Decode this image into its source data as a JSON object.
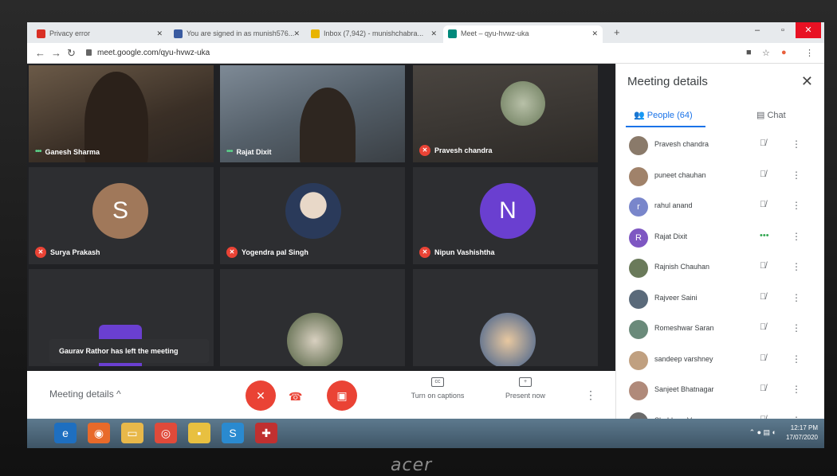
{
  "browser": {
    "tabs": [
      {
        "title": "Privacy error",
        "color": "#d93025"
      },
      {
        "title": "You are signed in as munish576...",
        "color": "#3a5ba0"
      },
      {
        "title": "Inbox (7,942) - munishchabra...",
        "color": "#e8b400"
      },
      {
        "title": "Meet – qyu-hvwz-uka",
        "color": "#00897b"
      }
    ],
    "url": "meet.google.com/qyu-hvwz-uka"
  },
  "tiles": [
    {
      "name": "Ganesh Sharma",
      "status": "speaking"
    },
    {
      "name": "Rajat Dixit",
      "status": "speaking"
    },
    {
      "name": "Pravesh chandra",
      "status": "muted"
    },
    {
      "name": "Surya Prakash",
      "status": "muted",
      "initial": "S",
      "avatar_color": "#a0785a"
    },
    {
      "name": "Yogendra pal Singh",
      "status": "muted"
    },
    {
      "name": "Nipun Vashishtha",
      "status": "muted",
      "initial": "N",
      "avatar_color": "#6a3fd0"
    }
  ],
  "toast": "Gaurav Rathor has left the meeting",
  "bottombar": {
    "meeting_details": "Meeting details",
    "captions": "Turn on captions",
    "present": "Present now"
  },
  "panel": {
    "title": "Meeting details",
    "people_tab": "People (64)",
    "chat_tab": "Chat",
    "people": [
      {
        "name": "Pravesh chandra",
        "initial": "",
        "color": "#8a7a6a",
        "status": "muted"
      },
      {
        "name": "puneet chauhan",
        "initial": "",
        "color": "#a0826a",
        "status": "muted"
      },
      {
        "name": "rahul anand",
        "initial": "r",
        "color": "#7986cb",
        "status": "muted"
      },
      {
        "name": "Rajat Dixit",
        "initial": "R",
        "color": "#7e57c2",
        "status": "speaking"
      },
      {
        "name": "Rajnish Chauhan",
        "initial": "",
        "color": "#6a7a5a",
        "status": "muted"
      },
      {
        "name": "Rajveer Saini",
        "initial": "",
        "color": "#5a6a7a",
        "status": "muted"
      },
      {
        "name": "Romeshwar Saran",
        "initial": "",
        "color": "#6a8a7a",
        "status": "muted"
      },
      {
        "name": "sandeep varshney",
        "initial": "",
        "color": "#c0a080",
        "status": "muted"
      },
      {
        "name": "Sanjeet Bhatnagar",
        "initial": "",
        "color": "#b08a7a",
        "status": "muted"
      },
      {
        "name": "Shubham Vyas",
        "initial": "",
        "color": "#6a6a6a",
        "status": "muted"
      }
    ]
  },
  "taskbar": {
    "time": "12:17 PM",
    "date": "17/07/2020"
  }
}
